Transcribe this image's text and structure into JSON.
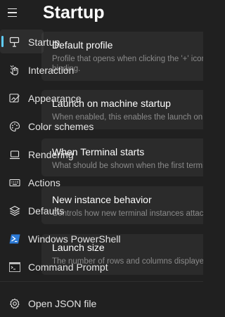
{
  "header": {
    "menu_icon": "hamburger-icon",
    "title": "Startup"
  },
  "nav": {
    "items": [
      {
        "label": "Startup",
        "icon": "startup-icon",
        "selected": true
      },
      {
        "label": "Interaction",
        "icon": "interaction-icon"
      },
      {
        "label": "Appearance",
        "icon": "appearance-icon"
      },
      {
        "label": "Color schemes",
        "icon": "palette-icon"
      },
      {
        "label": "Rendering",
        "icon": "laptop-icon"
      },
      {
        "label": "Actions",
        "icon": "keyboard-icon"
      },
      {
        "label": "Defaults",
        "icon": "layers-icon"
      },
      {
        "label": "Windows PowerShell",
        "icon": "powershell-icon"
      },
      {
        "label": "Command Prompt",
        "icon": "cmd-icon"
      }
    ],
    "footer": {
      "label": "Open JSON file",
      "icon": "gear-icon"
    },
    "accent": "#60cdff"
  },
  "settings": {
    "cards": [
      {
        "title": "Default profile",
        "desc": "Profile that opens when clicking the '+' icon",
        "desc2": "binding."
      },
      {
        "title": "Launch on machine startup",
        "desc": "When enabled, this enables the launch on"
      },
      {
        "title": "When Terminal starts",
        "desc": "What should be shown when the first terminal"
      },
      {
        "title": "New instance behavior",
        "desc": "Controls how new terminal instances attach"
      },
      {
        "title": "Launch size",
        "desc": "The number of rows and columns displayed"
      }
    ]
  }
}
